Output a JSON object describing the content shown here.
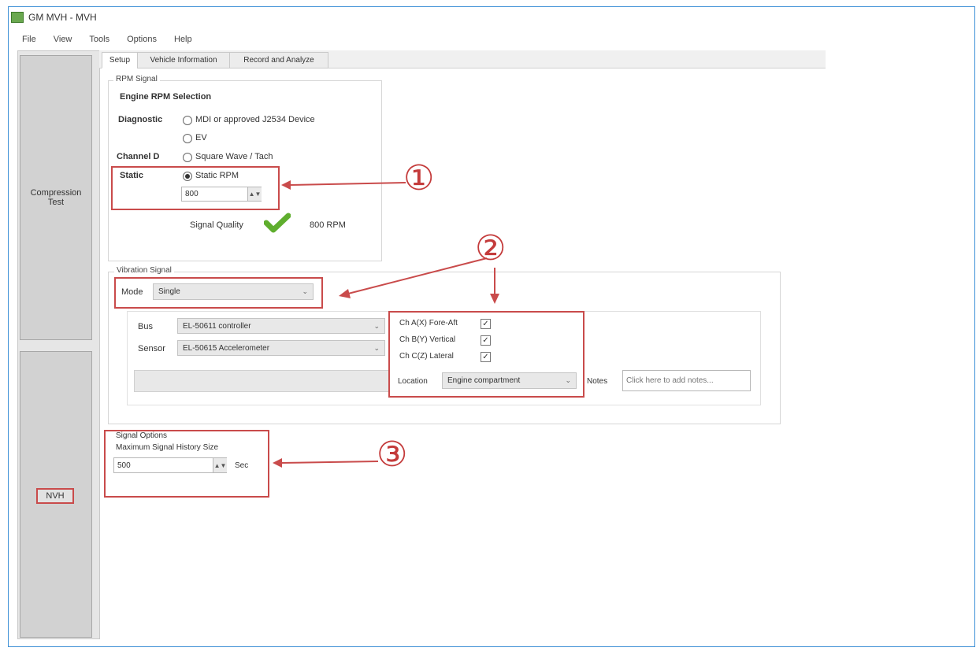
{
  "window": {
    "title": "GM MVH - MVH"
  },
  "menu": [
    "File",
    "View",
    "Tools",
    "Options",
    "Help"
  ],
  "side_tiles": {
    "compression": "Compression\nTest",
    "nvh": "NVH"
  },
  "tabs": [
    "Setup",
    "Vehicle Information",
    "Record and Analyze"
  ],
  "rpm_signal": {
    "group_title": "RPM Signal",
    "heading": "Engine RPM Selection",
    "diagnostic_label": "Diagnostic",
    "opt_mdi": "MDI or approved J2534 Device",
    "opt_ev": "EV",
    "channel_label": "Channel D",
    "opt_square": "Square Wave / Tach",
    "static_label": "Static",
    "opt_static_rpm": "Static RPM",
    "rpm_value": "800",
    "signal_quality_label": "Signal Quality",
    "rpm_readout": "800 RPM"
  },
  "vibration_signal": {
    "group_title": "Vibration Signal",
    "mode_label": "Mode",
    "mode_value": "Single",
    "bus_label": "Bus",
    "bus_value": "EL-50611 controller",
    "sensor_label": "Sensor",
    "sensor_value": "EL-50615 Accelerometer",
    "axis_x_label": "Ch A(X) Fore-Aft",
    "axis_y_label": "Ch B(Y) Vertical",
    "axis_z_label": "Ch C(Z) Lateral",
    "location_label": "Location",
    "location_value": "Engine compartment",
    "notes_label": "Notes",
    "notes_placeholder": "Click here to add notes..."
  },
  "signal_options": {
    "group_title": "Signal Options",
    "history_label": "Maximum Signal History Size",
    "history_value": "500",
    "unit": "Sec"
  },
  "callouts": [
    "①",
    "②",
    "③"
  ],
  "colors": {
    "accent_red": "#c94b4b",
    "check_green": "#5fae2e",
    "tile_gray": "#d2d2d2"
  }
}
